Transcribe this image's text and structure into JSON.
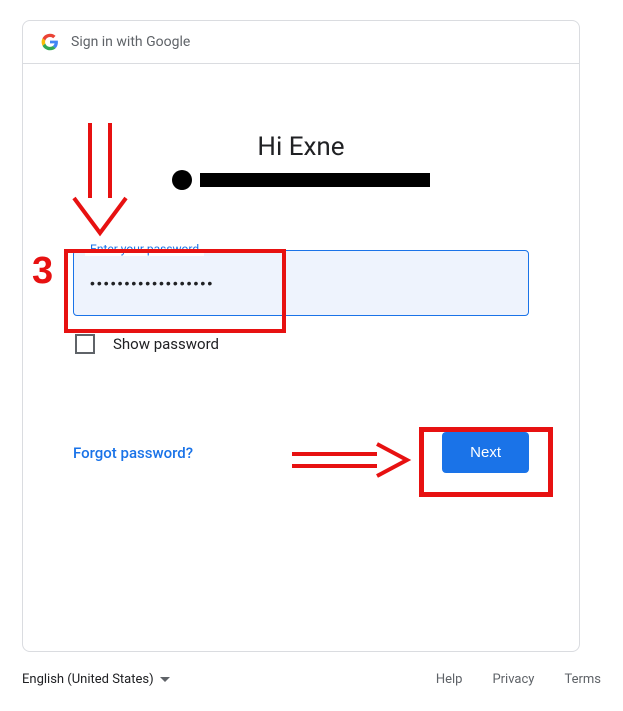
{
  "header": {
    "title": "Sign in with Google"
  },
  "main": {
    "greeting": "Hi Exne",
    "password_label": "Enter your password",
    "password_value": "••••••••••••••••••",
    "show_password_label": "Show password",
    "forgot_label": "Forgot password?",
    "next_label": "Next"
  },
  "footer": {
    "language": "English (United States)",
    "help": "Help",
    "privacy": "Privacy",
    "terms": "Terms"
  },
  "annotations": {
    "step_number": "3"
  }
}
